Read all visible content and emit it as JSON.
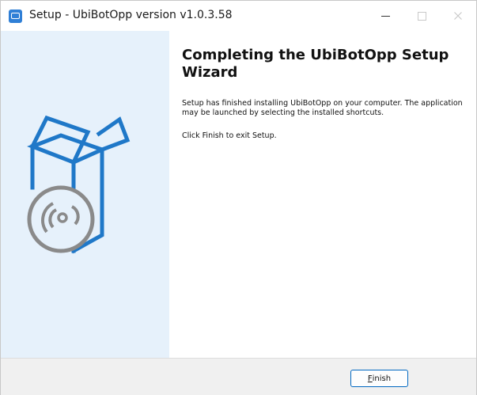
{
  "window": {
    "title": "Setup - UbiBotOpp version v1.0.3.58",
    "minimize_glyph": "—",
    "maximize_glyph": "☐",
    "close_glyph": "✕",
    "accent_color": "#0067c0",
    "sidebar_color": "#e6f1fb",
    "icon_color": "#2f7fd6"
  },
  "content": {
    "heading": "Completing the UbiBotOpp Setup Wizard",
    "paragraph1": "Setup has finished installing UbiBotOpp on your computer. The application may be launched by selecting the installed shortcuts.",
    "paragraph2": "Click Finish to exit Setup."
  },
  "sidebar": {
    "illustration": "software-box-with-disc-icon"
  },
  "footer": {
    "finish_first_letter": "F",
    "finish_rest": "inish"
  }
}
